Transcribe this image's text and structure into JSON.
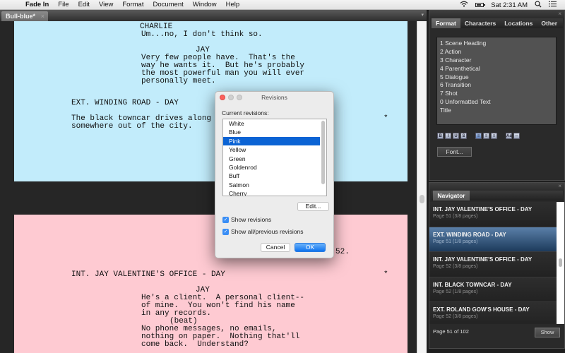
{
  "menubar": {
    "app_name": "Fade In",
    "items": [
      "File",
      "Edit",
      "View",
      "Format",
      "Document",
      "Window",
      "Help"
    ],
    "clock": "Sat 2:31 AM"
  },
  "tab": {
    "title": "Bull-blue*",
    "close_glyph": "×",
    "menu_glyph": "▾"
  },
  "script": {
    "blue_page": {
      "color": "#c2ecfb",
      "lines": [
        "CHARLIE",
        "Um...no, I don't think so.",
        "JAY",
        "Very few people have.  That's the",
        "way he wants it.  But he's probably",
        "the most powerful man you will ever",
        "personally meet.",
        "EXT. WINDING ROAD - DAY",
        "The black towncar drives along",
        "somewhere out of the city.",
        "*"
      ]
    },
    "pink_page": {
      "color": "#fecad2",
      "page_number": "52.",
      "lines": [
        "INT. JAY VALENTINE'S OFFICE - DAY",
        "*",
        "JAY",
        "He's a client.  A personal client--",
        "of mine.  You won't find his name",
        "in any records.",
        "(beat)",
        "No phone messages, no emails,",
        "nothing on paper.  Nothing that'll",
        "come back.  Understand?"
      ]
    }
  },
  "dialog": {
    "title": "Revisions",
    "label": "Current revisions:",
    "revisions": [
      "White",
      "Blue",
      "Pink",
      "Yellow",
      "Green",
      "Goldenrod",
      "Buff",
      "Salmon",
      "Cherry"
    ],
    "selected": "Pink",
    "edit_label": "Edit...",
    "show_revisions": {
      "label": "Show revisions",
      "checked": true
    },
    "show_all": {
      "label": "Show all/previous revisions",
      "checked": true
    },
    "cancel_label": "Cancel",
    "ok_label": "OK",
    "check_glyph": "✓"
  },
  "format_panel": {
    "tabs": [
      "Format",
      "Characters",
      "Locations",
      "Other"
    ],
    "active_tab": "Format",
    "styles": [
      "1 Scene Heading",
      "2 Action",
      "3 Character",
      "4 Parenthetical",
      "5 Dialogue",
      "6 Transition",
      "7 Shot",
      "0 Unformatted Text",
      "Title"
    ],
    "format_buttons": [
      "B",
      "I",
      "U",
      "S",
      "≡",
      "≡",
      "≡",
      "Aa",
      "⇔"
    ],
    "font_label": "Font..."
  },
  "navigator": {
    "tab": "Navigator",
    "scenes": [
      {
        "heading": "INT. JAY VALENTINE'S OFFICE - DAY",
        "sub": "Page 51 (3/8 pages)"
      },
      {
        "heading": "EXT. WINDING ROAD - DAY",
        "sub": "Page 51 (1/8 pages)",
        "selected": true
      },
      {
        "heading": "INT. JAY VALENTINE'S OFFICE - DAY",
        "sub": "Page 52 (3/8 pages)"
      },
      {
        "heading": "INT. BLACK TOWNCAR - DAY",
        "sub": "Page 52 (1/8 pages)"
      },
      {
        "heading": "EXT. ROLAND GOW'S HOUSE - DAY",
        "sub": "Page 52 (3/8 pages)"
      }
    ],
    "page_status": "Page 51 of 102",
    "show_label": "Show"
  },
  "close_glyph": "×"
}
